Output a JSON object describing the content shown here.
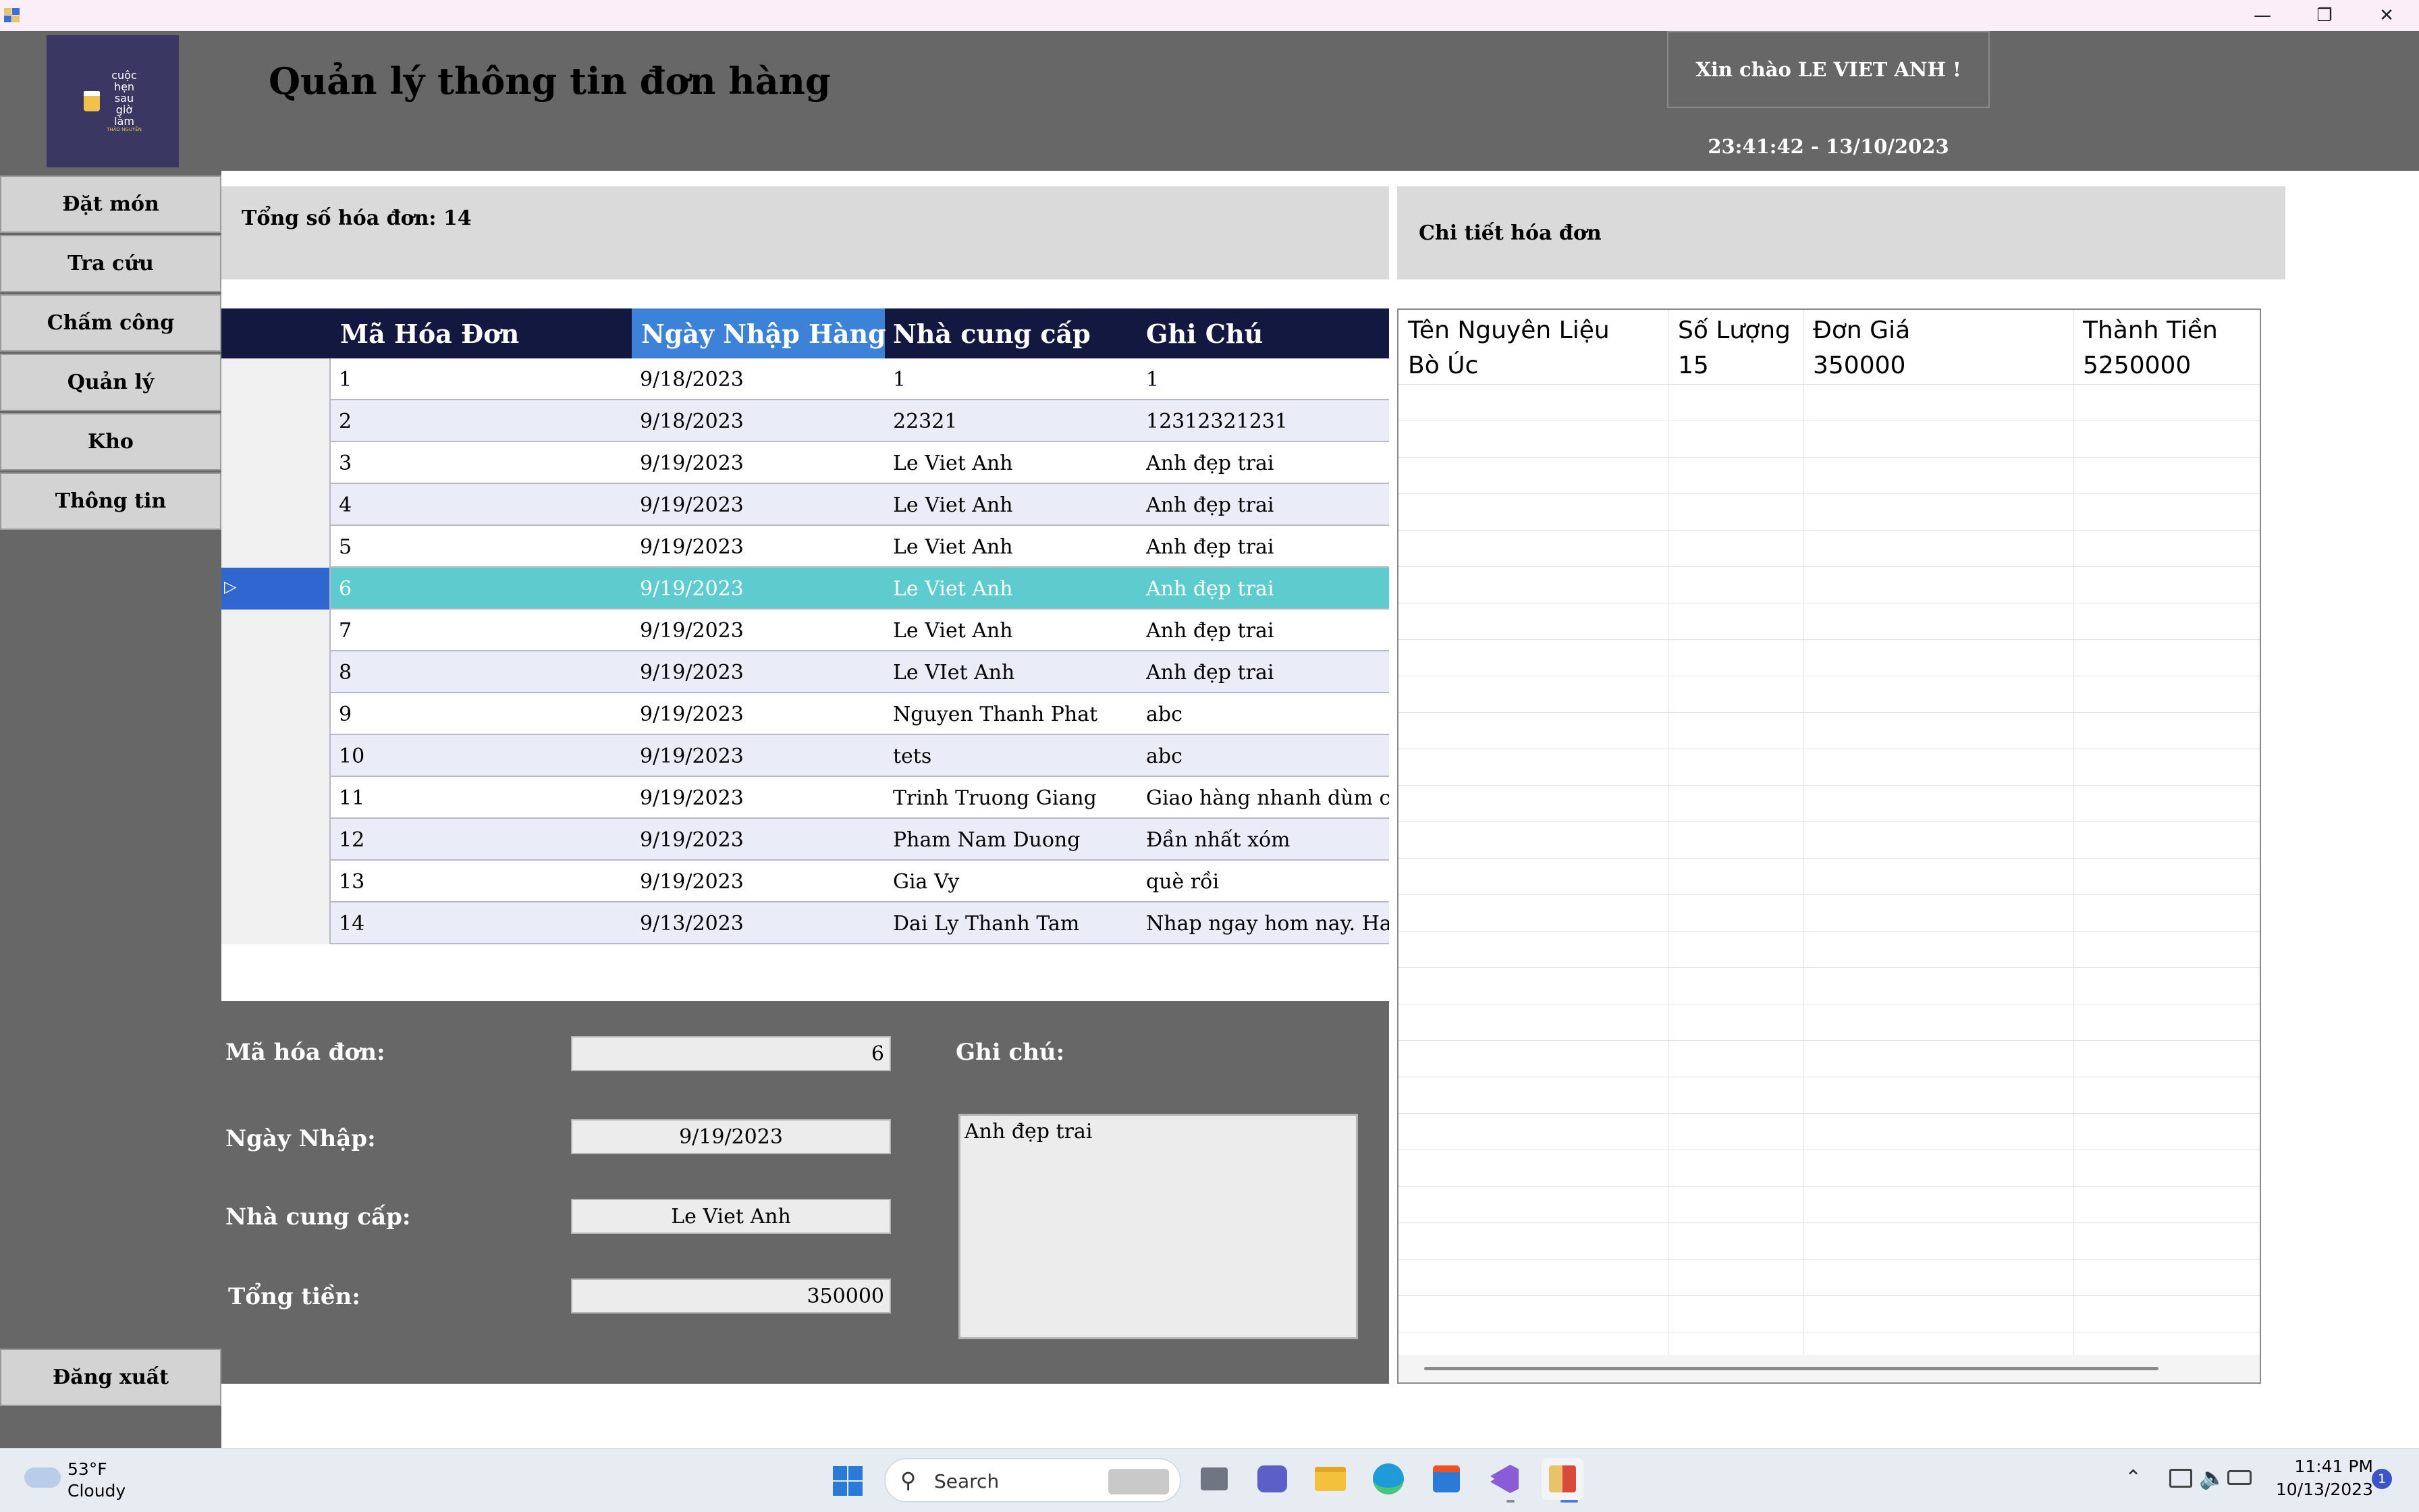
{
  "header": {
    "title": "Quản lý thông tin đơn hàng",
    "greeting": "Xin chào LE VIET ANH !",
    "clock": "23:41:42 - 13/10/2023",
    "logo_lines": [
      "cuộc",
      "hẹn",
      "sau",
      "giờ",
      "làm"
    ],
    "logo_tagline": "THẢO NGUYÊN"
  },
  "sidebar": {
    "items": [
      {
        "label": "Đặt món"
      },
      {
        "label": "Tra cứu"
      },
      {
        "label": "Chấm công"
      },
      {
        "label": "Quản lý"
      },
      {
        "label": "Kho"
      },
      {
        "label": "Thông tin"
      }
    ],
    "logout": "Đăng xuất"
  },
  "invoices": {
    "summary": "Tổng số hóa đơn: 14",
    "columns": [
      "Mã Hóa Đơn",
      "Ngày Nhập Hàng",
      "Nhà cung cấp",
      "Ghi Chú"
    ],
    "selected_index": 5,
    "rows": [
      [
        "1",
        "9/18/2023",
        "1",
        "1"
      ],
      [
        "2",
        "9/18/2023",
        "22321",
        "12312321231"
      ],
      [
        "3",
        "9/19/2023",
        "Le Viet Anh",
        "Anh đẹp trai"
      ],
      [
        "4",
        "9/19/2023",
        "Le Viet Anh",
        "Anh đẹp trai"
      ],
      [
        "5",
        "9/19/2023",
        "Le Viet Anh",
        "Anh đẹp trai"
      ],
      [
        "6",
        "9/19/2023",
        "Le Viet Anh",
        "Anh đẹp trai"
      ],
      [
        "7",
        "9/19/2023",
        "Le Viet Anh",
        "Anh đẹp trai"
      ],
      [
        "8",
        "9/19/2023",
        "Le VIet Anh",
        "Anh đẹp trai"
      ],
      [
        "9",
        "9/19/2023",
        "Nguyen Thanh Phat",
        "abc"
      ],
      [
        "10",
        "9/19/2023",
        "tets",
        "abc"
      ],
      [
        "11",
        "9/19/2023",
        "Trinh Truong Giang",
        "Giao hàng nhanh dùm cái"
      ],
      [
        "12",
        "9/19/2023",
        "Pham Nam Duong",
        "Đần nhất xóm"
      ],
      [
        "13",
        "9/19/2023",
        "Gia Vy",
        "què rồi"
      ],
      [
        "14",
        "9/13/2023",
        "Dai Ly Thanh Tam",
        "Nhap ngay hom nay. Ha..."
      ]
    ]
  },
  "form": {
    "invoice_id_label": "Mã hóa đơn:",
    "invoice_id_value": "6",
    "date_label": "Ngày Nhập:",
    "date_value": "9/19/2023",
    "supplier_label": "Nhà cung cấp:",
    "supplier_value": "Le Viet Anh",
    "total_label": "Tổng tiền:",
    "total_value": "350000",
    "note_label": "Ghi chú:",
    "note_value": "Anh đẹp trai"
  },
  "detail": {
    "header": "Chi tiết hóa đơn",
    "columns": [
      "Tên Nguyên Liệu",
      "Số Lượng",
      "Đơn Giá",
      "Thành Tiền"
    ],
    "rows": [
      [
        "Bò Úc",
        "15",
        "350000",
        "5250000"
      ]
    ]
  },
  "taskbar": {
    "weather_temp": "53°F",
    "weather_desc": "Cloudy",
    "search_placeholder": "Search",
    "time": "11:41 PM",
    "date": "10/13/2023",
    "notification_count": "1"
  },
  "colors": {
    "grid_header": "#12183f",
    "selected_row": "#5ecbcf",
    "sorted_header": "#3c82d8",
    "panel_bg": "#676767"
  }
}
